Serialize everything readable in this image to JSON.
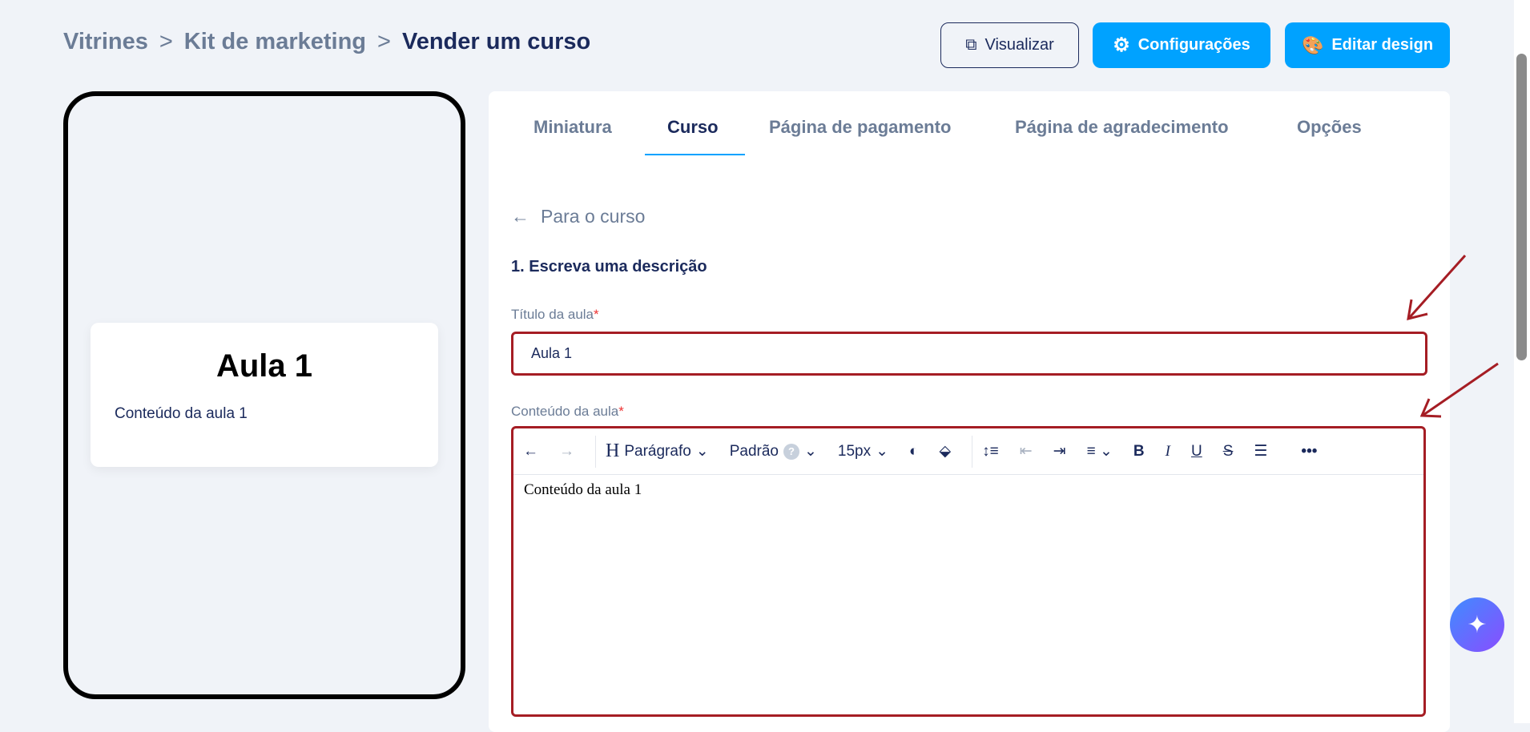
{
  "breadcrumb": [
    "Vitrines",
    "Kit de marketing",
    "Vender um curso"
  ],
  "buttons": {
    "preview": "Visualizar",
    "settings": "Configurações",
    "design": "Editar design"
  },
  "preview_card": {
    "title": "Aula 1",
    "content": "Conteúdo da aula 1"
  },
  "tabs": [
    "Miniatura",
    "Curso",
    "Página de pagamento",
    "Página de agradecimento",
    "Opções"
  ],
  "active_tab": "Curso",
  "back_link": "Para o curso",
  "section_title": "1. Escreva uma descrição",
  "title_field": {
    "label": "Título da aula",
    "required": "*",
    "value": "Aula 1"
  },
  "content_field": {
    "label": "Conteúdo da aula",
    "required": "*",
    "value": "Conteúdo da aula 1"
  },
  "toolbar": {
    "block": "Parágrafo",
    "font": "Padrão",
    "help": "?",
    "size": "15px"
  },
  "colors": {
    "accent": "#00a2ff",
    "annotation": "#a51d24",
    "text": "#1b2a5c"
  }
}
